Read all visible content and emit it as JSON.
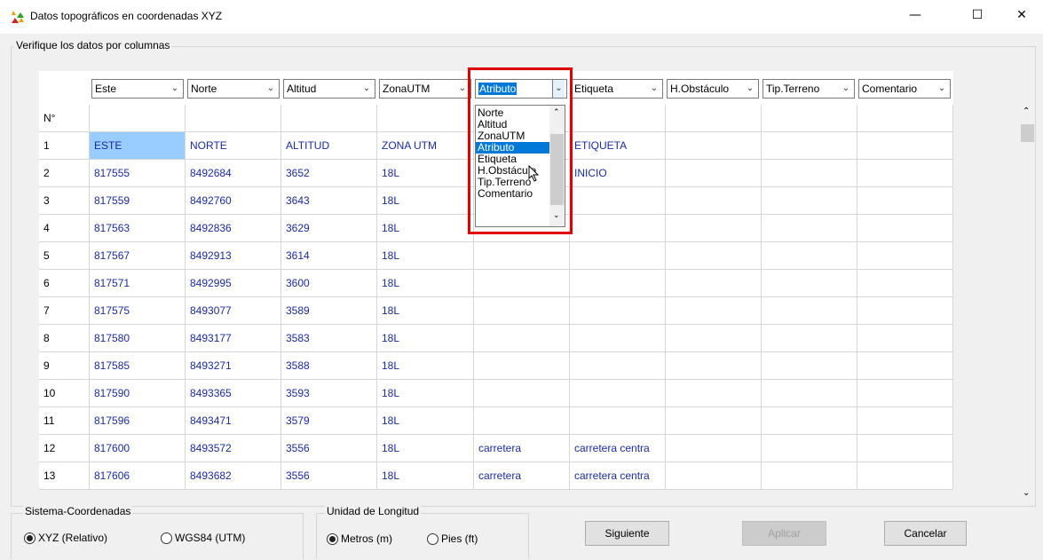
{
  "window": {
    "title": "Datos topográficos en coordenadas XYZ",
    "min": "—",
    "max": "☐",
    "close": "✕"
  },
  "group_main": {
    "label": "Verifique los datos por columnas"
  },
  "combos": [
    {
      "label": "Este"
    },
    {
      "label": "Norte"
    },
    {
      "label": "Altitud"
    },
    {
      "label": "ZonaUTM"
    },
    {
      "label": "Atributo"
    },
    {
      "label": "Etiqueta"
    },
    {
      "label": "H.Obstáculo"
    },
    {
      "label": "Tip.Terreno"
    },
    {
      "label": "Comentario"
    }
  ],
  "dropdown": {
    "items": [
      "Norte",
      "Altitud",
      "ZonaUTM",
      "Atributo",
      "Etiqueta",
      "H.Obstáculo",
      "Tip.Terreno",
      "Comentario"
    ],
    "selected": "Atributo"
  },
  "grid": {
    "header": [
      "N°",
      "",
      "",
      "",
      "",
      "",
      "",
      "",
      "",
      ""
    ],
    "rows": [
      [
        "1",
        "ESTE",
        "NORTE",
        "ALTITUD",
        "ZONA UTM",
        "",
        "ETIQUETA",
        "",
        "",
        ""
      ],
      [
        "2",
        "817555",
        "8492684",
        "3652",
        "18L",
        "",
        "INICIO",
        "",
        "",
        ""
      ],
      [
        "3",
        "817559",
        "8492760",
        "3643",
        "18L",
        "",
        "",
        "",
        "",
        ""
      ],
      [
        "4",
        "817563",
        "8492836",
        "3629",
        "18L",
        "",
        "",
        "",
        "",
        ""
      ],
      [
        "5",
        "817567",
        "8492913",
        "3614",
        "18L",
        "",
        "",
        "",
        "",
        ""
      ],
      [
        "6",
        "817571",
        "8492995",
        "3600",
        "18L",
        "",
        "",
        "",
        "",
        ""
      ],
      [
        "7",
        "817575",
        "8493077",
        "3589",
        "18L",
        "",
        "",
        "",
        "",
        ""
      ],
      [
        "8",
        "817580",
        "8493177",
        "3583",
        "18L",
        "",
        "",
        "",
        "",
        ""
      ],
      [
        "9",
        "817585",
        "8493271",
        "3588",
        "18L",
        "",
        "",
        "",
        "",
        ""
      ],
      [
        "10",
        "817590",
        "8493365",
        "3593",
        "18L",
        "",
        "",
        "",
        "",
        ""
      ],
      [
        "11",
        "817596",
        "8493471",
        "3579",
        "18L",
        "",
        "",
        "",
        "",
        ""
      ],
      [
        "12",
        "817600",
        "8493572",
        "3556",
        "18L",
        "carretera",
        "carretera centra",
        "",
        "",
        ""
      ],
      [
        "13",
        "817606",
        "8493682",
        "3556",
        "18L",
        "carretera",
        "carretera centra",
        "",
        "",
        ""
      ]
    ]
  },
  "group_coords": {
    "label": "Sistema-Coordenadas",
    "option1": "XYZ (Relativo)",
    "option2": "WGS84 (UTM)"
  },
  "group_units": {
    "label": "Unidad de Longitud",
    "option1": "Metros (m)",
    "option2": "Pies (ft)"
  },
  "buttons": {
    "next": "Siguiente",
    "apply": "Aplicar",
    "cancel": "Cancelar"
  },
  "colors": {
    "accent": "#0078d7",
    "highlight": "#e00000",
    "cell_text": "#1a2b9c",
    "selected_cell": "#99ccff"
  }
}
